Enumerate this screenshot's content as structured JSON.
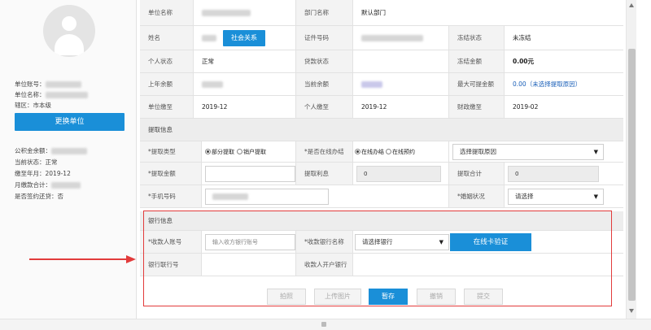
{
  "sidebar": {
    "unit_account_label": "单位账号：",
    "unit_name_label": "单位名称：",
    "district": "辖区：市本级",
    "switch_button": "更换单位",
    "fund_balance_label": "公积金余额：",
    "current_status": "当前状态：正常",
    "paid_until": "缴至年月：2019-12",
    "monthly_total_label": "月缴款合计：",
    "repay_signed": "是否签约还贷：否"
  },
  "info": {
    "unit_name_label": "单位名称",
    "dept_name_label": "部门名称",
    "dept_name_value": "默认部门",
    "name_label": "姓名",
    "social_button": "社会关系",
    "id_no_label": "证件号码",
    "freeze_status_label": "冻结状态",
    "freeze_status_value": "未冻结",
    "personal_status_label": "个人状态",
    "personal_status_value": "正常",
    "loan_status_label": "贷款状态",
    "freeze_amount_label": "冻结金额",
    "freeze_amount_value": "0.00元",
    "last_balance_label": "上年余额",
    "current_balance_label": "当前余额",
    "max_withdraw_label": "最大可提金额",
    "max_withdraw_value": "0.00（未选择提取原因）",
    "unit_paid_label": "单位缴至",
    "unit_paid_value": "2019-12",
    "personal_paid_label": "个人缴至",
    "personal_paid_value": "2019-12",
    "finance_paid_label": "财政缴至",
    "finance_paid_value": "2019-02"
  },
  "withdraw": {
    "section_title": "提取信息",
    "type_label": "*提取类型",
    "type_partial": "部分提取",
    "type_closing": "销户提取",
    "online_label": "*是否在线办结",
    "online_yes": "在线办结",
    "online_booking": "在线预约",
    "reason_select": "选择提取原因",
    "amount_label": "*提取金额",
    "interest_label": "提取利息",
    "interest_value": "0",
    "total_label": "提取合计",
    "total_value": "0",
    "phone_label": "*手机号码",
    "marital_label": "*婚姻状况",
    "marital_select": "请选择"
  },
  "bank": {
    "section_title": "银行信息",
    "payee_account_label": "*收款人账号",
    "payee_account_placeholder": "输入收方银行账号",
    "payee_bank_label": "*收款银行名称",
    "payee_bank_select": "请选择银行",
    "verify_button": "在线卡验证",
    "bank_branch_label": "银行联行号",
    "payee_branch_label": "收款人开户银行"
  },
  "actions": {
    "shoot": "拍照",
    "upload": "上传图片",
    "save": "暂存",
    "revoke": "撤销",
    "submit": "提交"
  }
}
